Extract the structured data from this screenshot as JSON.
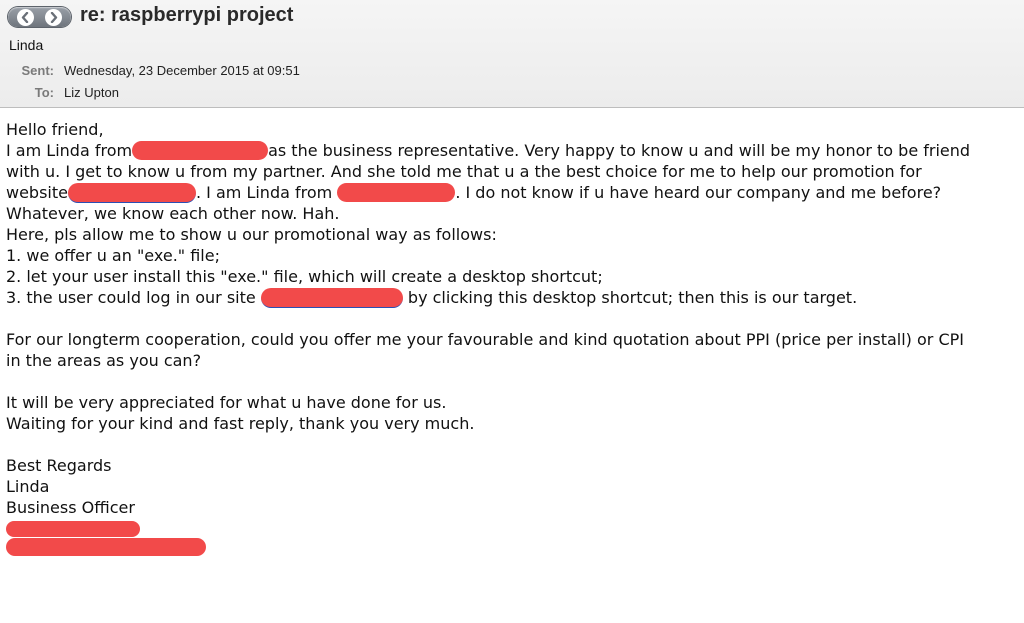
{
  "header": {
    "subject": "re: raspberrypi project",
    "sender": "Linda",
    "sent_label": "Sent:",
    "sent_value": "Wednesday, 23 December 2015 at 09:51",
    "to_label": "To:",
    "to_value": "Liz Upton",
    "nav": {
      "back_icon": "chevron-left-icon",
      "forward_icon": "chevron-right-icon"
    }
  },
  "body": {
    "greeting": "Hello friend,",
    "l1_a": "I am Linda from",
    "l1_b": "as the business representative. Very happy to know u and will be my honor to be friend",
    "l2": "with u. I get to know u from my partner. And she told me that u a the best choice for me to help our promotion for",
    "l3_a": "website",
    "l3_b": ". I am Linda from",
    "l3_c": ". I do not know if u have heard our company and me before?",
    "l4": "Whatever, we know each other now. Hah.",
    "l5": "Here, pls allow me to show u our promotional way as follows:",
    "l6": "1. we offer u an \"exe.\" file;",
    "l7": "2. let your user install this \"exe.\" file, which will create a desktop shortcut;",
    "l8_a": "3. the user could log in our site",
    "l8_b": "by clicking this desktop shortcut; then this is our target.",
    "l9": "For our longterm cooperation, could you offer me your favourable and kind quotation about PPI (price per install) or CPI",
    "l10": "in the areas as you can?",
    "l11": "It will be very appreciated for what u have done for us.",
    "l12": "Waiting for your kind and fast reply, thank you very much.",
    "sig1": "Best Regards",
    "sig2": "Linda",
    "sig3": "Business Officer"
  },
  "colors": {
    "redaction": "#f24a4a",
    "header_bg": "#ececec",
    "label_gray": "#7a7a7a"
  }
}
